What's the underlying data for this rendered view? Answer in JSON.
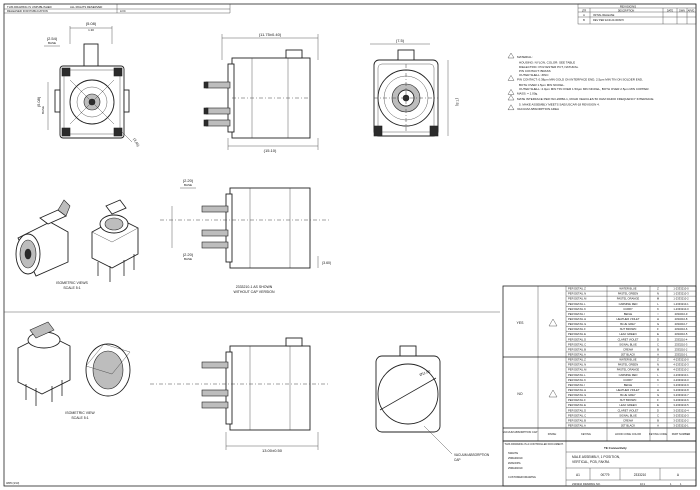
{
  "header": {
    "left_a": "THIS DRAWING IS UNPUBLISHED",
    "left_b": "RELEASED FOR PUBLICATION",
    "right_a": "ALL RIGHTS RESERVED",
    "right_b": "LOC",
    "revisions_title": "REVISIONS",
    "rev_cols": [
      "LTR",
      "DESCRIPTION",
      "DATE",
      "DWN",
      "APVD"
    ],
    "rev_rows": [
      [
        "A",
        "INITIAL RELEASE",
        "",
        "",
        ""
      ],
      [
        "B",
        "REV PER ECR-20-000970",
        "",
        "",
        ""
      ]
    ]
  },
  "dims": {
    "top_width": "(5.08)",
    "top_width_b": "1.30",
    "left_h": "(2.54)",
    "left_h_b": "BASE",
    "front_h": "(5.08)",
    "front_h_b": "BASE",
    "diag": "(3.45)",
    "side_top": "(11.75±0.40)",
    "side_bottom": "(15.10)",
    "end_top": "(7.5)",
    "end_right": "(7.5)",
    "lower_top_a": "(2.20)",
    "lower_top_b": "BASE",
    "lower_bottom_a": "(2.20)",
    "lower_bottom_b": "BASE",
    "lower_right": "(3.60)",
    "bottom_len": "13.00±0.50",
    "cap_dia": "Ø11.60"
  },
  "notes": [
    {
      "flag": "1",
      "text": "MATERIAL:"
    },
    {
      "flag": "",
      "text": "HOUSING: NYLON, COLOR: SEE TABLE"
    },
    {
      "flag": "",
      "text": "DIELECTRIC: POLYESTER PCT, NATURAL"
    },
    {
      "flag": "",
      "text": "PIN CONTACT: BRASS"
    },
    {
      "flag": "",
      "text": "OUTER SHELL: ZINC"
    },
    {
      "flag": "2",
      "text": "PIN CONTACT: 0.38µm MIN GOLD ON INTERFACE END, 2.5µm MIN TIN ON SOLDER END,"
    },
    {
      "flag": "",
      "text": "BOTH OVER 1.5µm MIN NICKEL."
    },
    {
      "flag": "",
      "text": "OUTER SHELL: 2.0µm MIN TIN OVER 1.50µm MIN NICKEL, BOTH OVER 2.5µm MIN COPPER."
    },
    {
      "flag": "3",
      "text": "MASS: ≈ 1.00g."
    },
    {
      "flag": "4",
      "text": "MATE INTERFACE PER ISO-20860-1, ROAD VEHICLES 50 OHM RADIO FREQUENCY INTERFACE."
    },
    {
      "flag": "",
      "text": "5. MAKE ASSEMBLY MEETS SAE/USCAR-18 REVISION 4."
    },
    {
      "flag": "6",
      "text": "VACUUM ABSORPTION AREA"
    }
  ],
  "captions": {
    "iso_top_a": "ISOMETRIC VIEWS",
    "iso_top_b": "SCALE 5:1",
    "variant_a": "2333210-1 AS SHOWN",
    "variant_b": "WITHOUT CAP VERSION",
    "iso_bottom_a": "ISOMETRIC VIEW",
    "iso_bottom_b": "SCALE 5:1",
    "vacuum_a": "VACUUM ABSORPTION",
    "vacuum_b": "CAP"
  },
  "table": {
    "group_yes": "YES",
    "group_no": "NO",
    "rows_yes": [
      {
        "d": "PER DETAIL Z",
        "c": "WATER BLUE",
        "k": "Z",
        "p": "1-2333210-0"
      },
      {
        "d": "PER DETAIL N",
        "c": "PASTEL GREEN",
        "k": "N",
        "p": "1-2333210-3"
      },
      {
        "d": "PER DETAIL M",
        "c": "PASTEL ORANGE",
        "k": "M",
        "p": "1-2333210-2"
      },
      {
        "d": "PER DETAIL L",
        "c": "CARMINE RED",
        "k": "L",
        "p": "1-2333210-1"
      },
      {
        "d": "PER DETAIL K",
        "c": "CURRY",
        "k": "K",
        "p": "1-2333210-0"
      },
      {
        "d": "PER DETAIL I",
        "c": "BEIGE",
        "k": "I",
        "p": "2333210-9"
      },
      {
        "d": "PER DETAIL H",
        "c": "HEATHER VIOLET",
        "k": "H",
        "p": "2333210-8"
      },
      {
        "d": "PER DETAIL G",
        "c": "BLUE GREY",
        "k": "G",
        "p": "2333210-7"
      },
      {
        "d": "PER DETAIL F",
        "c": "NUT BROWN",
        "k": "F",
        "p": "2333210-6"
      },
      {
        "d": "PER DETAIL E",
        "c": "LEAF GREEN",
        "k": "E",
        "p": "2333210-5"
      },
      {
        "d": "PER DETAIL D",
        "c": "CLARET VIOLET",
        "k": "D",
        "p": "2333210-4"
      },
      {
        "d": "PER DETAIL C",
        "c": "SIGNAL BLUE",
        "k": "C",
        "p": "2333210-3"
      },
      {
        "d": "PER DETAIL B",
        "c": "CREAM",
        "k": "B",
        "p": "2333210-2"
      },
      {
        "d": "PER DETAIL A",
        "c": "JET BLACK",
        "k": "A",
        "p": "2333210-1"
      }
    ],
    "rows_no": [
      {
        "d": "PER DETAIL Z",
        "c": "WATER BLUE",
        "k": "Z",
        "p": "4-2333210-0"
      },
      {
        "d": "PER DETAIL N",
        "c": "PASTEL GREEN",
        "k": "N",
        "p": "4-2333210-3"
      },
      {
        "d": "PER DETAIL M",
        "c": "PASTEL ORANGE",
        "k": "M",
        "p": "4-2333210-2"
      },
      {
        "d": "PER DETAIL L",
        "c": "CARMINE RED",
        "k": "L",
        "p": "4-2333210-1"
      },
      {
        "d": "PER DETAIL K",
        "c": "CURRY",
        "k": "K",
        "p": "4-2333210-0"
      },
      {
        "d": "PER DETAIL I",
        "c": "BEIGE",
        "k": "I",
        "p": "3-2333210-9"
      },
      {
        "d": "PER DETAIL H",
        "c": "HEATHER VIOLET",
        "k": "H",
        "p": "3-2333210-8"
      },
      {
        "d": "PER DETAIL G",
        "c": "BLUE GREY",
        "k": "G",
        "p": "3-2333210-7"
      },
      {
        "d": "PER DETAIL F",
        "c": "NUT BROWN",
        "k": "F",
        "p": "3-2333210-6"
      },
      {
        "d": "PER DETAIL E",
        "c": "LEAF GREEN",
        "k": "E",
        "p": "3-2333210-5"
      },
      {
        "d": "PER DETAIL D",
        "c": "CLARET VIOLET",
        "k": "D",
        "p": "3-2333210-4"
      },
      {
        "d": "PER DETAIL C",
        "c": "SIGNAL BLUE",
        "k": "C",
        "p": "3-2333210-3"
      },
      {
        "d": "PER DETAIL B",
        "c": "CREAM",
        "k": "B",
        "p": "3-2333210-2"
      },
      {
        "d": "PER DETAIL A",
        "c": "JET BLACK",
        "k": "A",
        "p": "3-2333210-1"
      }
    ],
    "headers": [
      "VACUUM ABSORPTION CAP",
      "FINISH",
      "KEYING",
      "HOOD CONE COLOR",
      "KEYING CODE",
      "PART NUMBER"
    ]
  },
  "title_block": {
    "controlled": "THIS DRAWING IS A CONTROLLED DOCUMENT.",
    "company": "TE Connectivity",
    "title_1": "MALE ASSEMBLY, 1 POSITION,",
    "title_2": "VERTICAL, PCB, FAKRA",
    "size": "A1",
    "cage": "00779",
    "dwg_no": "2333210",
    "rev": "A",
    "scale": "10:1",
    "sheet": "1",
    "of": "1",
    "names": [
      "SWHITE",
      "25MAR2019",
      "ZMANOPA",
      "25MAR2019"
    ],
    "customer_label": "CUSTOMER DRAWING",
    "footer": "2333210 DRAWING NO."
  },
  "corner": {
    "bottom_left": "4805 (3/13)"
  }
}
